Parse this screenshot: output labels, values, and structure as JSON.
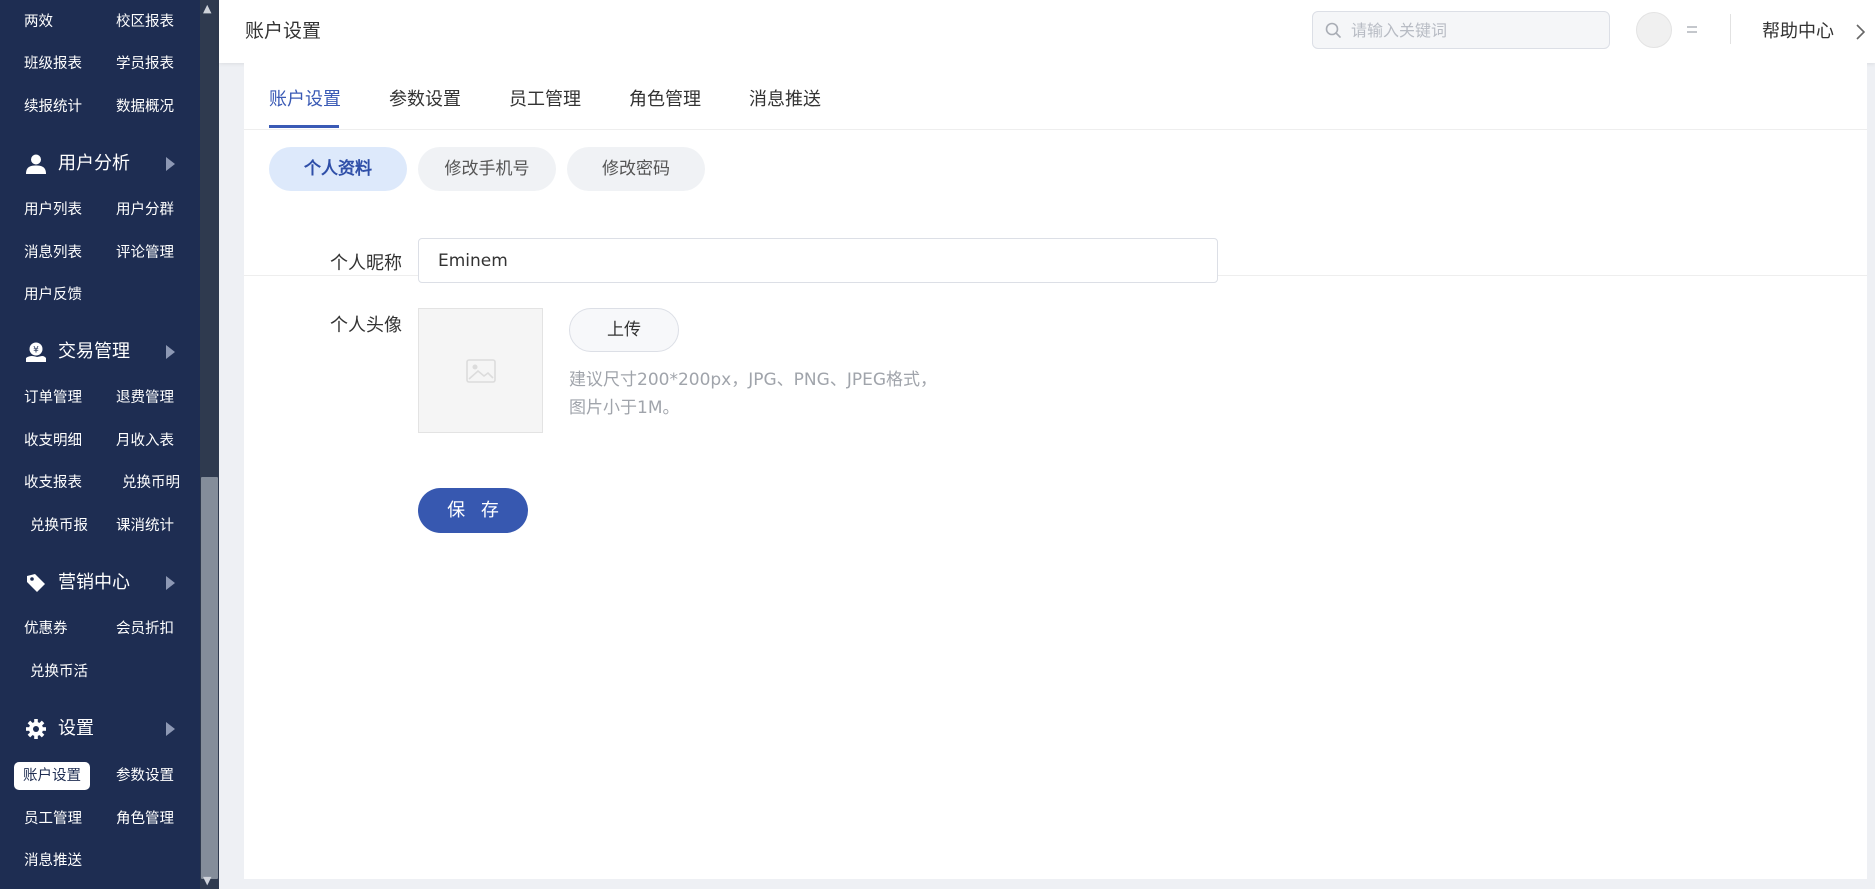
{
  "sidebar": {
    "grid_top": [
      {
        "left": "两效",
        "right": "校区报表"
      },
      {
        "left": "班级报表",
        "right": "学员报表"
      },
      {
        "left": "续报统计",
        "right": "数据概况"
      }
    ],
    "sections": [
      {
        "label": "用户分析",
        "icon": "user-icon",
        "rows": [
          {
            "left": "用户列表",
            "right": "用户分群"
          },
          {
            "left": "消息列表",
            "right": "评论管理"
          },
          {
            "left": "用户反馈",
            "right": ""
          }
        ]
      },
      {
        "label": "交易管理",
        "icon": "money-hand-icon",
        "rows": [
          {
            "left": "订单管理",
            "right": "退费管理"
          },
          {
            "left": "收支明细",
            "right": "月收入表"
          },
          {
            "left": "收支报表",
            "right": "兑换币明"
          },
          {
            "left": "兑换币报",
            "right": "课消统计"
          }
        ]
      },
      {
        "label": "营销中心",
        "icon": "tag-icon",
        "rows": [
          {
            "left": "优惠券",
            "right": "会员折扣"
          },
          {
            "left": "兑换币活",
            "right": ""
          }
        ]
      },
      {
        "label": "设置",
        "icon": "gear-icon",
        "rows": [
          {
            "left": "账户设置",
            "right": "参数设置"
          },
          {
            "left": "员工管理",
            "right": "角色管理"
          },
          {
            "left": "消息推送",
            "right": ""
          }
        ]
      }
    ]
  },
  "header": {
    "title": "账户设置",
    "search_placeholder": "请输入关键词",
    "help_label": "帮助中心"
  },
  "tabs": [
    "账户设置",
    "参数设置",
    "员工管理",
    "角色管理",
    "消息推送"
  ],
  "active_tab": "账户设置",
  "subtabs": [
    "个人资料",
    "修改手机号",
    "修改密码"
  ],
  "active_subtab": "个人资料",
  "form": {
    "nickname_label": "个人昵称",
    "nickname_value": "Eminem",
    "avatar_label": "个人头像",
    "upload_label": "上传",
    "hint_line1": "建议尺寸200*200px，JPG、PNG、JPEG格式，",
    "hint_line2": "图片小于1M。",
    "save_label": "保 存"
  },
  "colors": {
    "sidebar_bg": "#1e2d52",
    "accent": "#3a5ab5",
    "save_button": "#3758b0",
    "active_pill_bg": "#dde9fb"
  }
}
